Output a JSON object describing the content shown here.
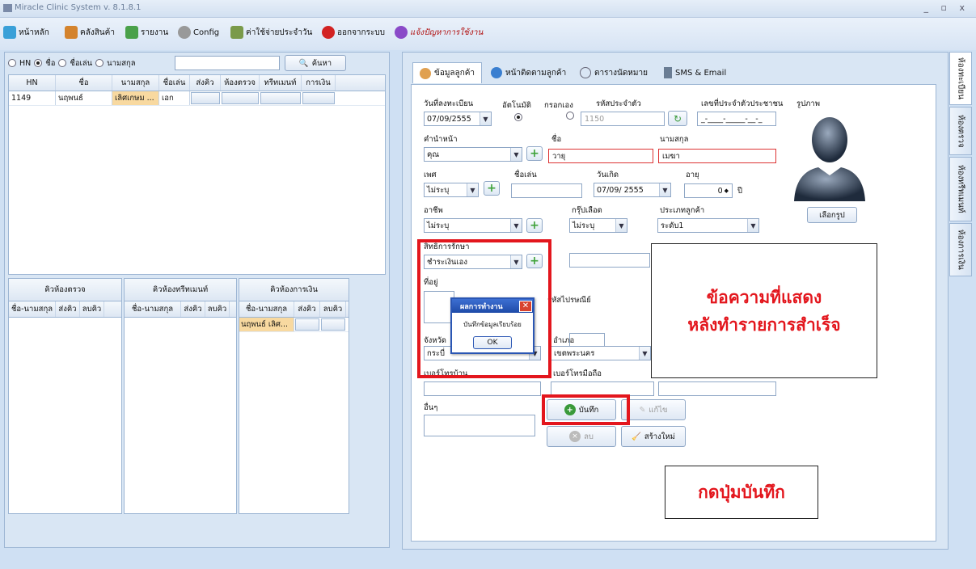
{
  "window": {
    "title": "Miracle Clinic System v. 8.1.8.1",
    "controls": "_ ▫ x"
  },
  "menu": [
    {
      "label": "หน้าหลัก",
      "icon": "home-icon",
      "color": "#3aa0d8"
    },
    {
      "label": "คลังสินค้า",
      "icon": "inventory-icon",
      "color": "#d4832d"
    },
    {
      "label": "รายงาน",
      "icon": "report-icon",
      "color": "#4aa14a"
    },
    {
      "label": "Config",
      "icon": "gear-icon",
      "color": "#888888"
    },
    {
      "label": "ค่าใช้จ่ายประจำวัน",
      "icon": "expense-icon",
      "color": "#7a9a4a"
    },
    {
      "label": "ออกจากระบบ",
      "icon": "power-icon",
      "color": "#d22222"
    },
    {
      "label": "แจ้งปัญหาการใช้งาน",
      "icon": "report-issue-icon",
      "color": "#8a4ac8"
    }
  ],
  "search": {
    "options": [
      "HN",
      "ชื่อ",
      "ชื่อเล่น",
      "นามสกุล"
    ],
    "selected": "ชื่อ",
    "value": "",
    "button": "ค้นหา"
  },
  "patients": {
    "columns": [
      "HN",
      "ชื่อ",
      "นามสกุล",
      "ชื่อเล่น",
      "ส่งคิว",
      "ห้องตรวจ",
      "ทรีทเมนท์",
      "การเงิน"
    ],
    "rows": [
      {
        "hn": "1149",
        "name": "นฤพนธ์",
        "surname": "เลิศเกษม ...",
        "nickname": "เอก"
      }
    ]
  },
  "queues": [
    {
      "title": "คิวห้องตรวจ",
      "cols": [
        "ชื่อ-นามสกุล",
        "ส่งคิว",
        "ลบคิว"
      ],
      "rows": []
    },
    {
      "title": "คิวห้องทรีทเมนท์",
      "cols": [
        "ชื่อ-นามสกุล",
        "ส่งคิว",
        "ลบคิว"
      ],
      "rows": []
    },
    {
      "title": "คิวห้องการเงิน",
      "cols": [
        "ชื่อ-นามสกุล",
        "ส่งคิว",
        "ลบคิว"
      ],
      "rows": [
        "นฤพนธ์ เลิศ..."
      ]
    }
  ],
  "tabs": [
    "ข้อมูลลูกค้า",
    "หน้าติดตามลูกค้า",
    "ตารางนัดหมาย",
    "SMS & Email"
  ],
  "vtabs": [
    "ห้องทะเบียน",
    "ห้องตรวจ",
    "ห้องทรีทเมนท์",
    "ห้องการเงิน"
  ],
  "form": {
    "reg_date_label": "วันที่ลงทะเบียน",
    "reg_date": "07/09/2555",
    "auto_label": "อัตโนมัติ",
    "manual_label": "กรอกเอง",
    "code_label": "รหัสประจำตัว",
    "code_value": "1150",
    "idcard_label": "เลขที่ประจำตัวประชาชน",
    "idcard_value": "_-____-_____-__-_",
    "photo_label": "รูปภาพ",
    "photo_button": "เลือกรูป",
    "prefix_label": "คำนำหน้า",
    "prefix": "คุณ",
    "name_label": "ชื่อ",
    "name": "วายุ",
    "surname_label": "นามสกุล",
    "surname": "เมฆา",
    "sex_label": "เพศ",
    "sex": "ไม่ระบุ",
    "nick_label": "ชื่อเล่น",
    "nick": "",
    "birth_label": "วันเกิด",
    "birth": "07/09/ 2555",
    "age_label": "อายุ",
    "age": "0",
    "age_unit": "ปี",
    "job_label": "อาชีพ",
    "job": "ไม่ระบุ",
    "blood_label": "กรุ๊ปเลือด",
    "blood": "ไม่ระบุ",
    "ctype_label": "ประเภทลูกค้า",
    "ctype": "ระดับ1",
    "pay_label": "สิทธิการรักษา",
    "pay": "ชำระเงินเอง",
    "addr_label": "ที่อยู่",
    "zip_label": "รหัสไปรษณีย์",
    "prov_label": "จังหวัด",
    "prov": "กระบี่",
    "dist_label": "อำเภอ",
    "dist": "เขตพระนคร",
    "phone_label": "เบอร์โทรบ้าน",
    "mobile_label": "เบอร์โทรมือถือ",
    "other_label": "อื่นๆ",
    "save": "บันทึก",
    "edit": "แก้ไข",
    "delete": "ลบ",
    "new": "สร้างใหม่"
  },
  "dialog": {
    "title": "ผลการทำงาน",
    "message": "บันทึกข้อมูลเรียบร้อย",
    "ok": "OK"
  },
  "annotations": {
    "message_note": [
      "ข้อความที่แสดง",
      "หลังทำรายการสำเร็จ"
    ],
    "save_note": "กดปุ่มบันทึก"
  }
}
